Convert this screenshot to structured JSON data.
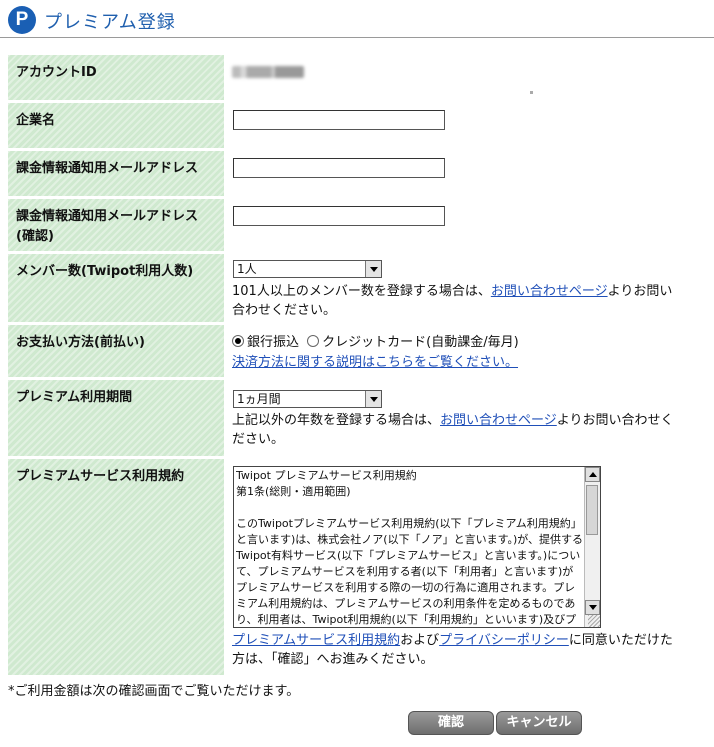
{
  "header": {
    "logo_letter": "P",
    "title": "プレミアム登録"
  },
  "fields": {
    "account_id": {
      "label": "アカウントID"
    },
    "company": {
      "label": "企業名",
      "value": ""
    },
    "billing_email": {
      "label": "課金情報通知用メールアドレス",
      "value": ""
    },
    "billing_email_confirm": {
      "label_line1": "課金情報通知用メールアドレス",
      "label_line2": "(確認)",
      "value": ""
    },
    "members": {
      "label": "メンバー数(Twipot利用人数)",
      "selected": "1人",
      "note_before": "101人以上のメンバー数を登録する場合は、",
      "note_link": "お問い合わせページ",
      "note_after": "よりお問い合わせください。"
    },
    "payment": {
      "label": "お支払い方法(前払い)",
      "option_bank": "銀行振込",
      "option_card": "クレジットカード(自動課金/毎月)",
      "selected": "銀行振込",
      "link": "決済方法に関する説明はこちらをご覧ください。"
    },
    "period": {
      "label": "プレミアム利用期間",
      "selected": "1ヵ月間",
      "note_before": "上記以外の年数を登録する場合は、",
      "note_link": "お問い合わせページ",
      "note_after": "よりお問い合わせください。"
    },
    "terms": {
      "label": "プレミアムサービス利用規約",
      "text": "Twipot プレミアムサービス利用規約\n第1条(総則・適用範囲)\n\nこのTwipotプレミアムサービス利用規約(以下「プレミアム利用規約」と言います)は、株式会社ノア(以下「ノア」と言います。)が、提供するTwipot有料サービス(以下「プレミアムサービス」と言います。)について、プレミアムサービスを利用する者(以下「利用者」と言います)がプレミアムサービスを利用する際の一切の行為に適用されます。プレミアム利用規約は、プレミアムサービスの利用条件を定めるものであり、利用者は、Twipot利用規約(以下「利用規約」といいます)及びプレミアム利用規",
      "link_terms": "プレミアムサービス利用規約",
      "and": "および",
      "link_privacy": "プライバシーポリシー",
      "agree_after": "に同意いただけた方は、「確認」へお進みください。"
    }
  },
  "footnote": "*ご利用金額は次の確認画面でご覧いただけます。",
  "buttons": {
    "confirm": "確認",
    "cancel": "キャンセル"
  },
  "colors": {
    "label_bg": "#cfe9cf",
    "title": "#1f5fae",
    "link": "#1f4fb8",
    "button": "#7f7f7f"
  }
}
